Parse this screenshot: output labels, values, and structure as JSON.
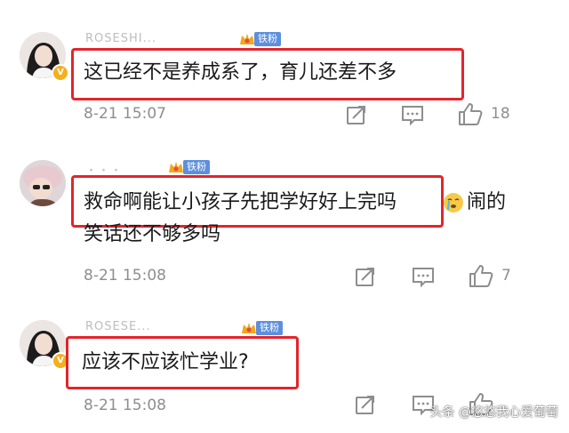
{
  "comments": [
    {
      "username": "ROSESHI...",
      "badge": "铁粉",
      "text": "这已经不是养成系了，育儿还差不多",
      "time": "8-21 15:07",
      "likes": "18"
    },
    {
      "username": "・・・",
      "badge": "铁粉",
      "text_line1": "救命啊能让小孩子先把学好好上完吗",
      "text_line1_tail": "闹的",
      "text_line2": "笑话还不够多吗",
      "time": "8-21 15:08",
      "likes": "7"
    },
    {
      "username": "ROSESE...",
      "badge": "铁粉",
      "text": "应该不应该忙学业?",
      "time": "8-21 15:08",
      "likes": ""
    }
  ],
  "watermark": "头条 @悠悠我心爱葡萄",
  "colors": {
    "highlight": "#e2252b",
    "badge_blue": "#5d8fdc",
    "meta_gray": "#8e8e8e"
  },
  "icons": [
    "repost-icon",
    "comment-icon",
    "like-icon",
    "crown-icon",
    "sob-emoji-icon"
  ]
}
